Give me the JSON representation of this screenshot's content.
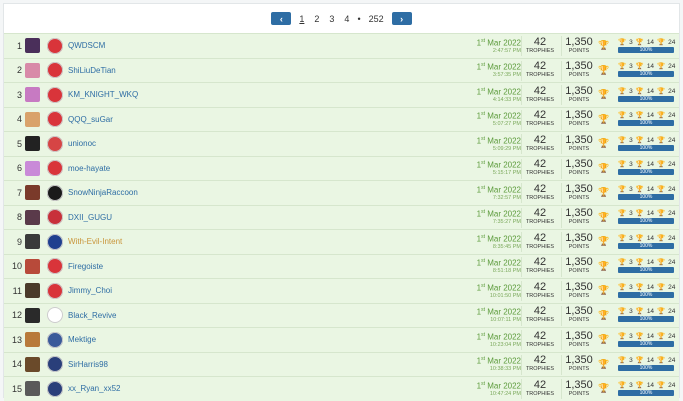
{
  "pagination": {
    "prev_icon": "chevron-left-icon",
    "next_icon": "chevron-right-icon",
    "pages": [
      "1",
      "2",
      "3",
      "4"
    ],
    "dots": "•",
    "last": "252"
  },
  "labels": {
    "trophies": "TROPHIES",
    "points": "POINTS"
  },
  "rows": [
    {
      "rank": "1",
      "name": "QWDSCM",
      "date": "Mar 2022",
      "time": "2:47:57 PM",
      "trophies": "42",
      "points": "1,350",
      "gold": "3",
      "silver": "14",
      "bronze": "24",
      "progress": "100%",
      "flag_color": "#d9343a",
      "avatar_color": "#4a2f5a",
      "name_color": "blue"
    },
    {
      "rank": "2",
      "name": "ShiLiuDeTian",
      "date": "Mar 2022",
      "time": "3:57:35 PM",
      "trophies": "42",
      "points": "1,350",
      "gold": "3",
      "silver": "14",
      "bronze": "24",
      "progress": "100%",
      "flag_color": "#d9343a",
      "avatar_color": "#d88aa8",
      "name_color": "blue"
    },
    {
      "rank": "3",
      "name": "KM_KNIGHT_WKQ",
      "date": "Mar 2022",
      "time": "4:14:33 PM",
      "trophies": "42",
      "points": "1,350",
      "gold": "3",
      "silver": "14",
      "bronze": "24",
      "progress": "100%",
      "flag_color": "#d9343a",
      "avatar_color": "#c77ac2",
      "name_color": "blue"
    },
    {
      "rank": "4",
      "name": "QQQ_suGar",
      "date": "Mar 2022",
      "time": "5:07:27 PM",
      "trophies": "42",
      "points": "1,350",
      "gold": "3",
      "silver": "14",
      "bronze": "24",
      "progress": "100%",
      "flag_color": "#d9343a",
      "avatar_color": "#d9a26a",
      "name_color": "blue"
    },
    {
      "rank": "5",
      "name": "unionoc",
      "date": "Mar 2022",
      "time": "5:09:29 PM",
      "trophies": "42",
      "points": "1,350",
      "gold": "3",
      "silver": "14",
      "bronze": "24",
      "progress": "100%",
      "flag_color": "#d64545",
      "avatar_color": "#222222",
      "name_color": "blue"
    },
    {
      "rank": "6",
      "name": "moe-hayate",
      "date": "Mar 2022",
      "time": "5:15:17 PM",
      "trophies": "42",
      "points": "1,350",
      "gold": "3",
      "silver": "14",
      "bronze": "24",
      "progress": "100%",
      "flag_color": "#d9343a",
      "avatar_color": "#c98ad8",
      "name_color": "blue"
    },
    {
      "rank": "7",
      "name": "SnowNinjaRaccoon",
      "date": "Mar 2022",
      "time": "7:32:57 PM",
      "trophies": "42",
      "points": "1,350",
      "gold": "3",
      "silver": "14",
      "bronze": "24",
      "progress": "100%",
      "flag_color": "#1a1a1a",
      "avatar_color": "#7a3a2a",
      "name_color": "blue"
    },
    {
      "rank": "8",
      "name": "DXII_GUGU",
      "date": "Mar 2022",
      "time": "7:35:27 PM",
      "trophies": "42",
      "points": "1,350",
      "gold": "3",
      "silver": "14",
      "bronze": "24",
      "progress": "100%",
      "flag_color": "#c8303a",
      "avatar_color": "#5a3a4a",
      "name_color": "blue"
    },
    {
      "rank": "9",
      "name": "With-Evil-Intent",
      "date": "Mar 2022",
      "time": "8:35:45 PM",
      "trophies": "42",
      "points": "1,350",
      "gold": "3",
      "silver": "14",
      "bronze": "24",
      "progress": "100%",
      "flag_color": "#1f3f8f",
      "avatar_color": "#3a3a3a",
      "name_color": "gold"
    },
    {
      "rank": "10",
      "name": "Firegoiste",
      "date": "Mar 2022",
      "time": "8:51:18 PM",
      "trophies": "42",
      "points": "1,350",
      "gold": "3",
      "silver": "14",
      "bronze": "24",
      "progress": "100%",
      "flag_color": "#d9343a",
      "avatar_color": "#b84a3a",
      "name_color": "blue"
    },
    {
      "rank": "11",
      "name": "Jimmy_Choi",
      "date": "Mar 2022",
      "time": "10:01:50 PM",
      "trophies": "42",
      "points": "1,350",
      "gold": "3",
      "silver": "14",
      "bronze": "24",
      "progress": "100%",
      "flag_color": "#d9343a",
      "avatar_color": "#4a3a2a",
      "name_color": "blue"
    },
    {
      "rank": "12",
      "name": "Black_Revive",
      "date": "Mar 2022",
      "time": "10:07:11 PM",
      "trophies": "42",
      "points": "1,350",
      "gold": "3",
      "silver": "14",
      "bronze": "24",
      "progress": "100%",
      "flag_color": "#ffffff",
      "avatar_color": "#2a2a2a",
      "name_color": "blue"
    },
    {
      "rank": "13",
      "name": "Mektige",
      "date": "Mar 2022",
      "time": "10:23:04 PM",
      "trophies": "42",
      "points": "1,350",
      "gold": "3",
      "silver": "14",
      "bronze": "24",
      "progress": "100%",
      "flag_color": "#3a5a9a",
      "avatar_color": "#b87a3a",
      "name_color": "blue"
    },
    {
      "rank": "14",
      "name": "SirHarris98",
      "date": "Mar 2022",
      "time": "10:38:33 PM",
      "trophies": "42",
      "points": "1,350",
      "gold": "3",
      "silver": "14",
      "bronze": "24",
      "progress": "100%",
      "flag_color": "#2a3f7a",
      "avatar_color": "#6a4a2a",
      "name_color": "blue"
    },
    {
      "rank": "15",
      "name": "xx_Ryan_xx52",
      "date": "Mar 2022",
      "time": "10:47:24 PM",
      "trophies": "42",
      "points": "1,350",
      "gold": "3",
      "silver": "14",
      "bronze": "24",
      "progress": "100%",
      "flag_color": "#2a3f7a",
      "avatar_color": "#5a5a5a",
      "name_color": "blue"
    }
  ],
  "date_sup": "st"
}
